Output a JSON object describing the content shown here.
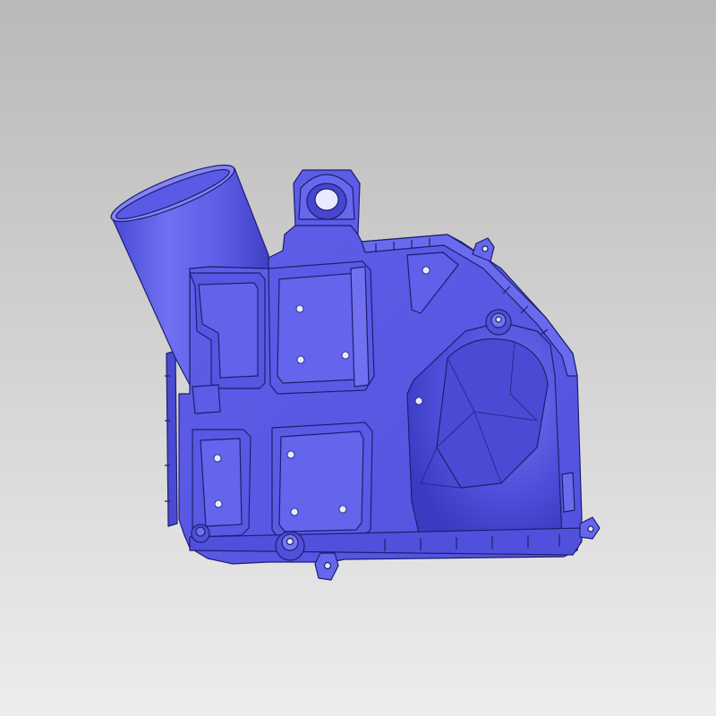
{
  "viewport": {
    "background_top": "#b9b9b9",
    "background_bottom": "#ededed"
  },
  "model": {
    "name": "air-filter-housing",
    "shaded_color": "#5a5ae8",
    "shadow_color": "#3c3cc8",
    "highlight_color": "#8a8af7",
    "edge_color": "#1e1e6e",
    "hole_color": "#e9e9ff"
  }
}
